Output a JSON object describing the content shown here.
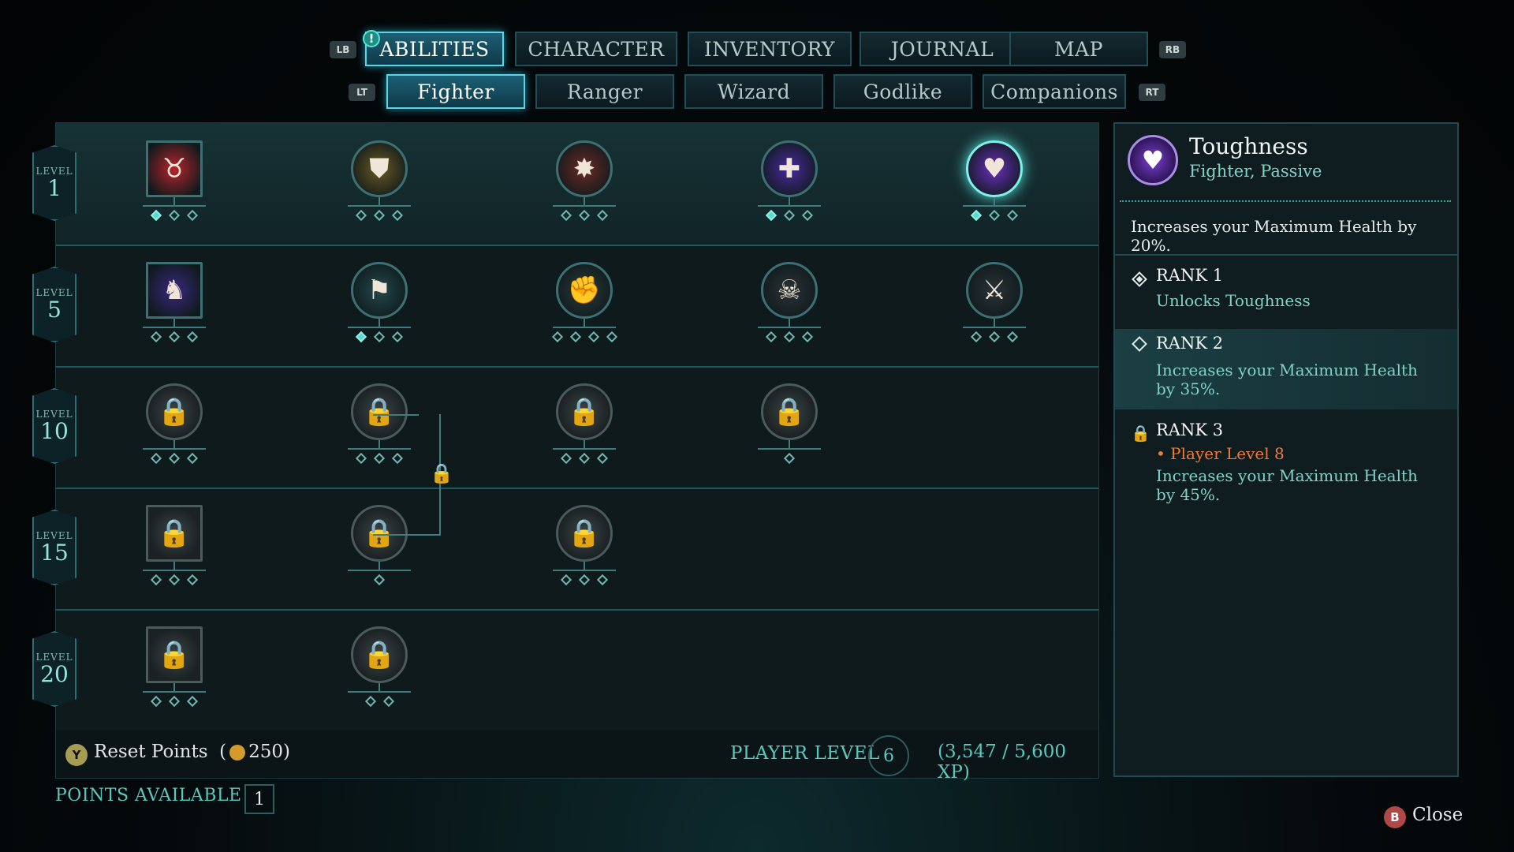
{
  "top_nav": {
    "left_hint": "LB",
    "right_hint": "RB",
    "notification": "!",
    "tabs": [
      "ABILITIES",
      "CHARACTER",
      "INVENTORY",
      "JOURNAL",
      "MAP"
    ],
    "active": "ABILITIES"
  },
  "sub_nav": {
    "left_hint": "LT",
    "right_hint": "RT",
    "tabs": [
      "Fighter",
      "Ranger",
      "Wizard",
      "Godlike",
      "Companions"
    ],
    "active": "Fighter"
  },
  "tree": {
    "level_word": "LEVEL",
    "rows": [
      {
        "level": "1",
        "abilities": [
          {
            "shape": "square",
            "icon": "bull-emblem-icon",
            "glyph": "♉",
            "color": "#b8242e",
            "pips": [
              1,
              0,
              0
            ],
            "locked": false
          },
          {
            "shape": "circle",
            "icon": "golden-shield-icon",
            "glyph": "⛊",
            "color": "#6b5a22",
            "pips": [
              0,
              0,
              0
            ],
            "locked": false
          },
          {
            "shape": "circle",
            "icon": "shield-bash-icon",
            "glyph": "✸",
            "color": "#6b2a26",
            "pips": [
              0,
              0,
              0
            ],
            "locked": false
          },
          {
            "shape": "circle",
            "icon": "purple-crosses-icon",
            "glyph": "✚",
            "color": "#4a2aa0",
            "pips": [
              1,
              0,
              0
            ],
            "locked": false
          },
          {
            "shape": "circle",
            "icon": "heart-toughness-icon",
            "glyph": "♥",
            "color": "#6a2fc0",
            "pips": [
              1,
              0,
              0
            ],
            "locked": false,
            "selected": true
          }
        ]
      },
      {
        "level": "5",
        "abilities": [
          {
            "shape": "square",
            "icon": "purple-beast-icon",
            "glyph": "♞",
            "color": "#3a2880",
            "pips": [
              0,
              0,
              0
            ],
            "locked": false
          },
          {
            "shape": "circle",
            "icon": "banner-icon",
            "glyph": "⚑",
            "color": "#23484c",
            "pips": [
              1,
              0,
              0
            ],
            "locked": false
          },
          {
            "shape": "circle",
            "icon": "punch-fist-icon",
            "glyph": "✊",
            "color": "#2a3a3c",
            "pips": [
              0,
              0,
              0,
              0
            ],
            "locked": false
          },
          {
            "shape": "circle",
            "icon": "skull-sword-icon",
            "glyph": "☠",
            "color": "#2a3436",
            "pips": [
              0,
              0,
              0
            ],
            "locked": false
          },
          {
            "shape": "circle",
            "icon": "double-axe-icon",
            "glyph": "⚔",
            "color": "#2a3436",
            "pips": [
              0,
              0,
              0
            ],
            "locked": false
          }
        ]
      },
      {
        "level": "10",
        "abilities": [
          {
            "shape": "circle",
            "icon": "locked-ability-icon",
            "glyph": "🔒",
            "pips": [
              0,
              0,
              0
            ],
            "locked": true
          },
          {
            "shape": "circle",
            "icon": "locked-ability-icon",
            "glyph": "🔒",
            "pips": [
              0,
              0,
              0
            ],
            "locked": true
          },
          {
            "shape": "circle",
            "icon": "locked-ability-icon",
            "glyph": "🔒",
            "pips": [
              0,
              0,
              0
            ],
            "locked": true
          },
          {
            "shape": "circle",
            "icon": "locked-ability-icon",
            "glyph": "🔒",
            "pips": [
              0
            ],
            "locked": true
          }
        ]
      },
      {
        "level": "15",
        "abilities": [
          {
            "shape": "square",
            "icon": "locked-ability-icon",
            "glyph": "🔒",
            "pips": [
              0,
              0,
              0
            ],
            "locked": true
          },
          {
            "shape": "circle",
            "icon": "locked-ability-icon",
            "glyph": "🔒",
            "pips": [
              0
            ],
            "locked": true
          },
          {
            "shape": "circle",
            "icon": "locked-ability-icon",
            "glyph": "🔒",
            "pips": [
              0,
              0,
              0
            ],
            "locked": true
          }
        ]
      },
      {
        "level": "20",
        "abilities": [
          {
            "shape": "square",
            "icon": "locked-ability-icon",
            "glyph": "🔒",
            "pips": [
              0,
              0,
              0
            ],
            "locked": true
          },
          {
            "shape": "circle",
            "icon": "locked-ability-icon",
            "glyph": "🔒",
            "pips": [
              0,
              0
            ],
            "locked": true
          }
        ]
      }
    ]
  },
  "footer": {
    "reset_button": "Y",
    "reset_label": "Reset Points",
    "reset_cost_open": "(",
    "reset_cost": "250",
    "reset_cost_close": ")",
    "player_level_label": "PLAYER LEVEL",
    "player_level": "6",
    "xp": "(3,547 / 5,600 XP)",
    "points_label": "POINTS AVAILABLE",
    "points": "1",
    "close_button": "B",
    "close_label": "Close"
  },
  "detail": {
    "title": "Toughness",
    "subtitle": "Fighter, Passive",
    "description": "Increases your Maximum Health by 20%.",
    "ranks": [
      {
        "title": "RANK 1",
        "desc": "Unlocks Toughness",
        "state": "owned"
      },
      {
        "title": "RANK 2",
        "desc": "Increases your Maximum Health by 35%.",
        "state": "next"
      },
      {
        "title": "RANK 3",
        "requirement": "• Player Level 8",
        "desc": "Increases your Maximum Health by 45%.",
        "state": "locked"
      }
    ]
  },
  "colors": {
    "accent": "#5fd3e6",
    "teal_text": "#59c9bd",
    "lock_orange": "#e2772a"
  }
}
